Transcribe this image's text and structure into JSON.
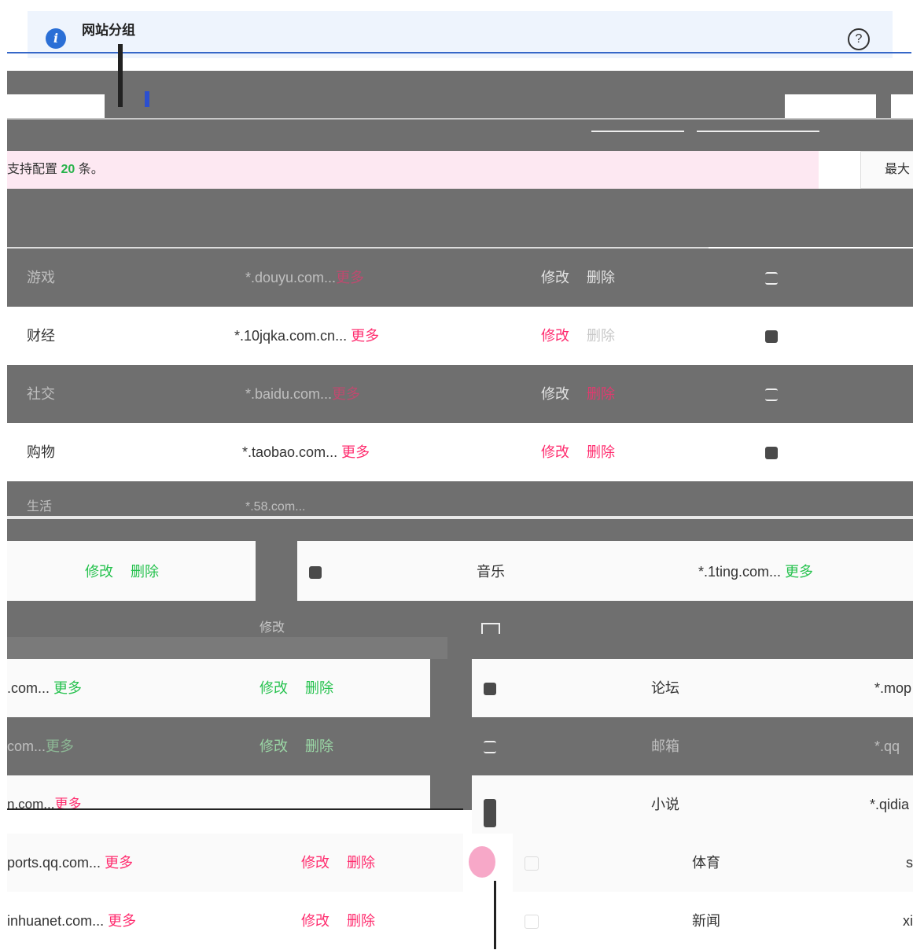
{
  "banner": {
    "title": "网站分组"
  },
  "notice": {
    "prefix": "支持配置",
    "count": "20",
    "suffix": "条。",
    "max_label": "最大"
  },
  "actions": {
    "edit": "修改",
    "delete": "删除",
    "more": "更多"
  },
  "rows": [
    {
      "name": "游戏",
      "domain": "*.douyu.com..."
    },
    {
      "name": "财经",
      "domain": "*.10jqka.com.cn..."
    },
    {
      "name": "社交",
      "domain": "*.baidu.com..."
    },
    {
      "name": "购物",
      "domain": "*.taobao.com..."
    },
    {
      "name": "生活",
      "domain": "*.58.com..."
    }
  ],
  "right_rows": [
    {
      "name": "音乐",
      "domain": "*.1ting.com..."
    },
    {
      "name": "论坛",
      "domain": "*.mop"
    },
    {
      "name": "邮箱",
      "domain": "*.qq"
    },
    {
      "name": "小说",
      "domain": "*.qidia"
    },
    {
      "name": "体育",
      "domain": "s"
    },
    {
      "name": "新闻",
      "domain": "xi"
    }
  ],
  "left_fragments": [
    {
      "domain": ".com..."
    },
    {
      "domain": "com..."
    },
    {
      "domain": "n.com..."
    },
    {
      "domain": "ports.qq.com..."
    },
    {
      "domain": "inhuanet.com..."
    }
  ]
}
